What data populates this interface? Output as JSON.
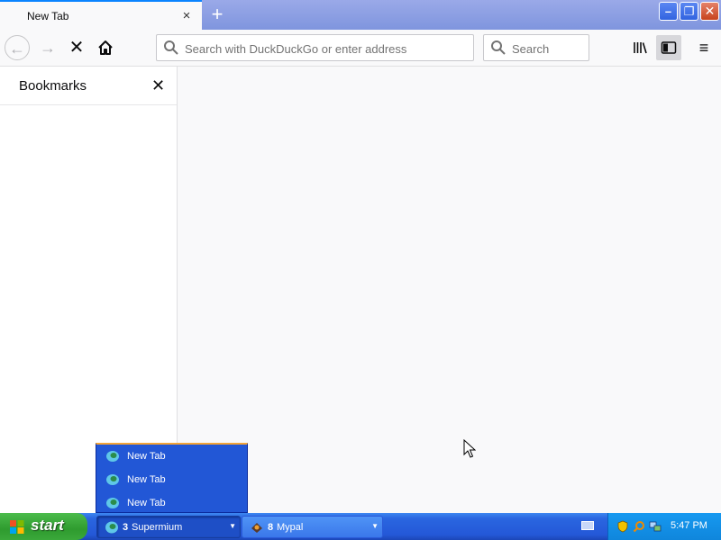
{
  "browser": {
    "tab": {
      "title": "New Tab",
      "close_glyph": "×"
    },
    "new_tab_glyph": "+",
    "window_controls": {
      "minimize": "–",
      "maximize": "❐",
      "close": "✕"
    },
    "nav": {
      "back_glyph": "←",
      "forward_glyph": "→",
      "stop_glyph": "✕",
      "home_icon": "home-icon"
    },
    "urlbar": {
      "placeholder": "Search with DuckDuckGo or enter address",
      "value": ""
    },
    "searchbar": {
      "placeholder": "Search",
      "value": ""
    },
    "tools": {
      "library_glyph": "|||\\",
      "menu_glyph": "≡"
    },
    "sidebar": {
      "title": "Bookmarks",
      "close_glyph": "✕"
    }
  },
  "taskbar_popup": {
    "items": [
      {
        "label": "New Tab"
      },
      {
        "label": "New Tab"
      },
      {
        "label": "New Tab"
      }
    ]
  },
  "taskbar": {
    "start_label": "start",
    "tasks": [
      {
        "count": "3",
        "label": "Supermium",
        "active": true
      },
      {
        "count": "8",
        "label": "Mypal",
        "active": false
      }
    ],
    "clock": "5:47 PM"
  },
  "colors": {
    "accent": "#0a84ff",
    "taskbar_blue": "#2458d8",
    "start_green": "#3aa83a",
    "tray_blue": "#0f86dc",
    "window_close_red": "#c7431d"
  }
}
